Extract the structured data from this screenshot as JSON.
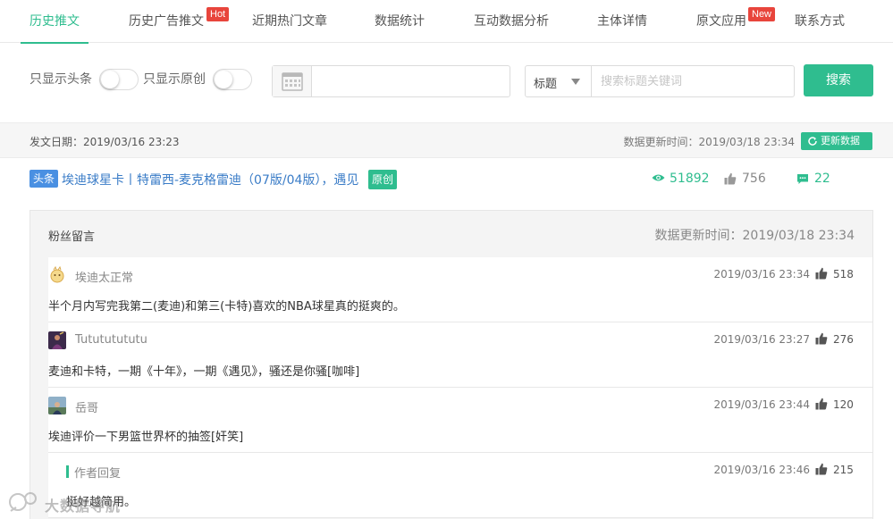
{
  "tabs": [
    {
      "label": "历史推文",
      "active": true
    },
    {
      "label": "历史广告推文",
      "badge": "Hot"
    },
    {
      "label": "近期热门文章"
    },
    {
      "label": "数据统计"
    },
    {
      "label": "互动数据分析"
    },
    {
      "label": "主体详情"
    },
    {
      "label": "原文应用",
      "badge": "New"
    },
    {
      "label": "联系方式"
    }
  ],
  "filters": {
    "headline_only_label": "只显示头条",
    "original_only_label": "只显示原创",
    "date_value": "",
    "search_field_selected": "标题",
    "search_placeholder": "搜索标题关键词",
    "search_value": "",
    "search_button": "搜索"
  },
  "info": {
    "post_date": "发文日期：2019/03/16 23:23",
    "data_update": "数据更新时间：2019/03/18 23:34",
    "refresh_button": "更新数据"
  },
  "article": {
    "badge": "头条",
    "title": "埃迪球星卡丨特雷西-麦克格雷迪（07版/04版），遇见",
    "original_badge": "原创",
    "views": "51892",
    "likes": "756",
    "comments": "22"
  },
  "comments_panel": {
    "title": "粉丝留言",
    "update_time": "数据更新时间：2019/03/18 23:34",
    "comments": [
      {
        "user": "埃迪太正常",
        "time": "2019/03/16 23:34",
        "likes": "518",
        "text": "半个月内写完我第二(麦迪)和第三(卡特)喜欢的NBA球星真的挺爽的。"
      },
      {
        "user": "Tutututututu",
        "time": "2019/03/16 23:27",
        "likes": "276",
        "text": "麦迪和卡特，一期《十年》，一期《遇见》，骚还是你骚[咖啡]"
      },
      {
        "user": "岳哥",
        "time": "2019/03/16 23:44",
        "likes": "120",
        "text": "埃迪评价一下男篮世界杯的抽签[奸笑]"
      },
      {
        "user": "作者回复",
        "time": "2019/03/16 23:46",
        "likes": "215",
        "text": "挺好越简用。",
        "is_reply": true
      }
    ]
  },
  "watermark": {
    "text": "大数据导航"
  },
  "colors": {
    "accent": "#2fbd8f",
    "hot_badge": "#e8453c",
    "link_blue": "#3a7cc7",
    "headline_badge": "#4a90e2"
  }
}
